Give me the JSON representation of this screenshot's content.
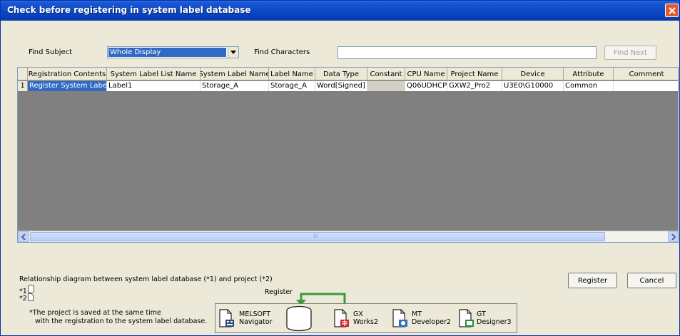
{
  "window": {
    "title": "Check before registering in system label database"
  },
  "search": {
    "subject_label": "Find Subject",
    "subject_value": "Whole Display",
    "characters_label": "Find Characters",
    "characters_value": "",
    "find_next_label": "Find Next"
  },
  "table": {
    "columns": [
      "Registration Contents",
      "System Label List Name",
      "System Label Name",
      "Label Name",
      "Data Type",
      "Constant",
      "CPU Name",
      "Project Name",
      "Device",
      "Attribute",
      "Comment"
    ],
    "rows": [
      {
        "num": "1",
        "registration_contents": "Register System Label",
        "system_label_list_name": "Label1",
        "system_label_name": "Storage_A",
        "label_name": "Storage_A",
        "data_type": "Word[Signed]",
        "constant": "",
        "cpu_name": "Q06UDHCPU",
        "project_name": "GXW2_Pro2",
        "device": "U3E0\\G10000",
        "attribute": "Common",
        "comment": ""
      }
    ],
    "scroll_thumb_text": "III"
  },
  "relationship": {
    "title": "Relationship diagram between system label database (*1) and project (*2)",
    "note1_marker": "*1",
    "note2_marker": "*2",
    "footnote_line1": "*The project is saved at the same time",
    "footnote_line2": "with the registration to the system label database.",
    "register_caption": "Register",
    "nodes": [
      {
        "line1": "MELSOFT",
        "line2": "Navigator",
        "icon": "navigator-icon"
      },
      {
        "line1": "GX",
        "line2": "Works2",
        "icon": "gx-works2-icon"
      },
      {
        "line1": "MT",
        "line2": "Developer2",
        "icon": "mt-developer2-icon"
      },
      {
        "line1": "GT",
        "line2": "Designer3",
        "icon": "gt-designer3-icon"
      }
    ]
  },
  "buttons": {
    "register": "Register",
    "cancel": "Cancel"
  },
  "colors": {
    "title_bar": "#0a49c8",
    "selection": "#316ac5",
    "arrow_green": "#3a9a3a",
    "close_red": "#e35a2d"
  }
}
